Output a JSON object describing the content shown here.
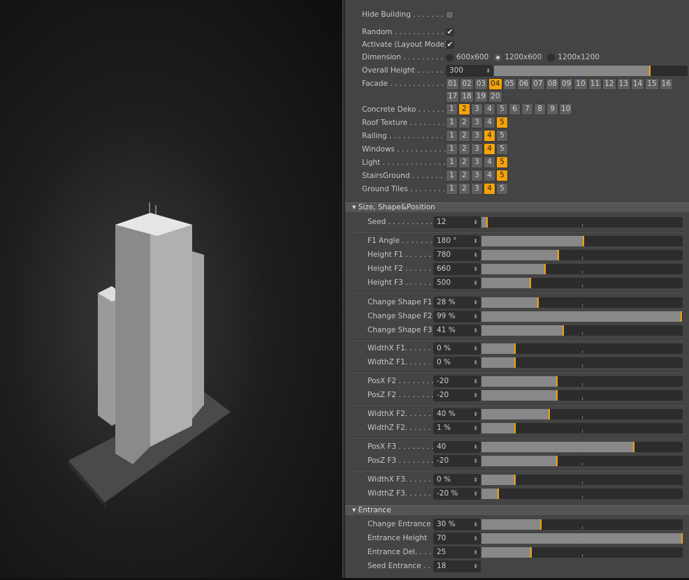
{
  "top": {
    "hide_building": {
      "label": "Hide Building . . . . . . . .",
      "checked": false
    },
    "random": {
      "label": "Random . . . . . . . . . . . . .",
      "checked": true
    },
    "activate": {
      "label": "Activate (Layout Mode)",
      "checked": true
    },
    "check_glyph": "✔",
    "dimension": {
      "label": "Dimension . . . . . . . . . . .",
      "options": [
        "600x600",
        "1200x600",
        "1200x1200"
      ],
      "selected": "1200x600"
    },
    "overall_height": {
      "label": "Overall Height . . . . . . .",
      "value": "300",
      "fraction": 0.81
    },
    "facade": {
      "label": "Facade . . . . . . . . . . . . . .",
      "options": [
        "01",
        "02",
        "03",
        "04",
        "05",
        "06",
        "07",
        "08",
        "09",
        "10",
        "11",
        "12",
        "13",
        "14",
        "15",
        "16",
        "17",
        "18",
        "19",
        "20"
      ],
      "selected": "04"
    },
    "concrete": {
      "label": "Concrete Deko . . . . . . .",
      "options": [
        "1",
        "2",
        "3",
        "4",
        "5",
        "6",
        "7",
        "8",
        "9",
        "10"
      ],
      "selected": "2"
    },
    "small": [
      {
        "label": "Roof Texture . . . . . . . .",
        "selected": "5"
      },
      {
        "label": "Railing . . . . . . . . . . . . .",
        "selected": "4"
      },
      {
        "label": "Windows . . . . . . . . . . . .",
        "selected": "4"
      },
      {
        "label": "Light . . . . . . . . . . . . . . .",
        "selected": "5"
      },
      {
        "label": "StairsGround . . . . . . . .",
        "selected": "5"
      },
      {
        "label": "Ground Tiles . . . . . . . .",
        "selected": "4"
      }
    ],
    "small_options": [
      "1",
      "2",
      "3",
      "4",
      "5"
    ]
  },
  "section1": {
    "title": "Size, Shape&Position",
    "groups": [
      [
        {
          "label": "Seed . . . . . . . . . . .",
          "value": "12",
          "fraction": 0.03
        }
      ],
      [
        {
          "label": "F1 Angle . . . . . . . .",
          "value": "180 °",
          "fraction": 0.51
        },
        {
          "label": "Height F1 . . . . . . .",
          "value": "780",
          "fraction": 0.385
        },
        {
          "label": "Height F2 . . . . . . .",
          "value": "660",
          "fraction": 0.32
        },
        {
          "label": "Height F3 . . . . . . .",
          "value": "500",
          "fraction": 0.245
        }
      ],
      [
        {
          "label": "Change Shape F1",
          "value": "28 %",
          "fraction": 0.285
        },
        {
          "label": "Change Shape F2",
          "value": "99 %",
          "fraction": 0.995
        },
        {
          "label": "Change Shape F3",
          "value": "41 %",
          "fraction": 0.41
        }
      ],
      [
        {
          "label": "WidthX F1. . . . . . .",
          "value": "0 %",
          "fraction": 0.17
        },
        {
          "label": "WidthZ F1. . . . . . .",
          "value": "0 %",
          "fraction": 0.17
        }
      ],
      [
        {
          "label": "PosX F2 . . . . . . . .",
          "value": "-20",
          "fraction": 0.38
        },
        {
          "label": "PosZ F2 . . . . . . . .",
          "value": "-20",
          "fraction": 0.38
        }
      ],
      [
        {
          "label": "WidthX F2. . . . . . .",
          "value": "40 %",
          "fraction": 0.34
        },
        {
          "label": "WidthZ F2. . . . . . .",
          "value": "1 %",
          "fraction": 0.17
        }
      ],
      [
        {
          "label": "PosX F3 . . . . . . . .",
          "value": "40",
          "fraction": 0.76
        },
        {
          "label": "PosZ F3 . . . . . . . .",
          "value": "-20",
          "fraction": 0.38
        }
      ],
      [
        {
          "label": "WidthX F3. . . . . . .",
          "value": "0 %",
          "fraction": 0.17
        },
        {
          "label": "WidthZ F3. . . . . . .",
          "value": "-20 %",
          "fraction": 0.087
        }
      ]
    ]
  },
  "section2": {
    "title": "Entrance",
    "rows": [
      {
        "label": "Change Entrance",
        "value": "30 %",
        "fraction": 0.3
      },
      {
        "label": "Entrance Height",
        "value": "70",
        "fraction": 1.0
      },
      {
        "label": "Entrance Del. . . . . .",
        "value": "25",
        "fraction": 0.25
      },
      {
        "label": "Seed Entrance . . .",
        "value": "18"
      }
    ]
  },
  "colors": {
    "accent": "#f5a30a",
    "panel": "#444444"
  }
}
